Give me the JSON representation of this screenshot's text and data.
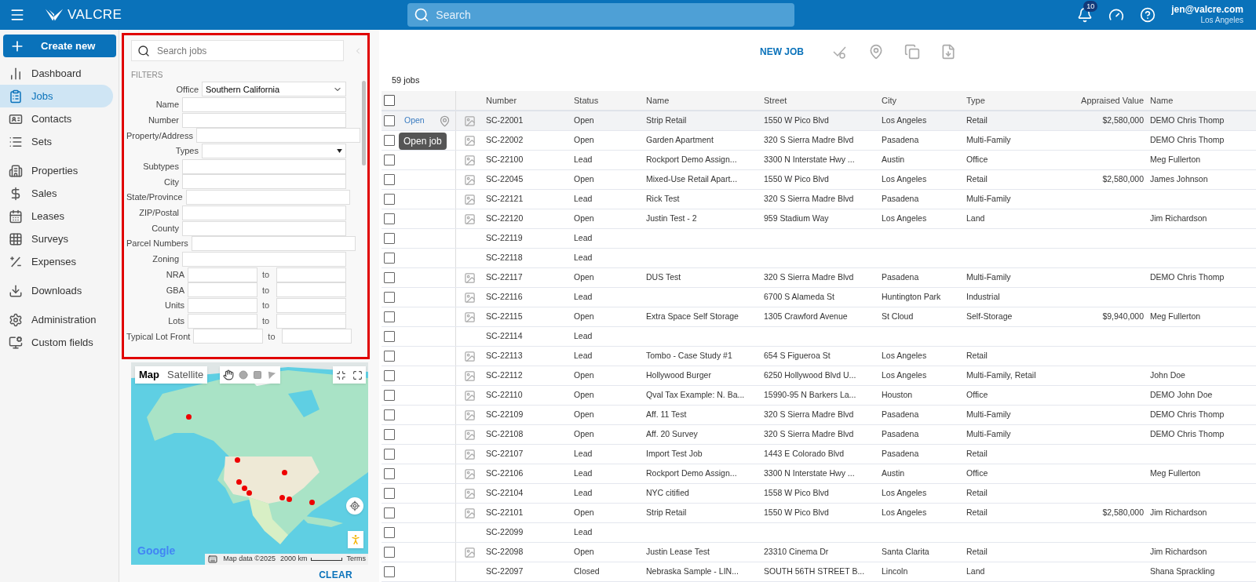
{
  "topbar": {
    "brand": "VALCRE",
    "search_placeholder": "Search",
    "notifications": "10",
    "user": "jen@valcre.com",
    "location": "Los Angeles"
  },
  "sidebar": {
    "create_button": "Create new",
    "groups": [
      {
        "items": [
          {
            "label": "Dashboard",
            "selected": false
          },
          {
            "label": "Jobs",
            "selected": true
          },
          {
            "label": "Contacts",
            "selected": false
          },
          {
            "label": "Sets",
            "selected": false
          }
        ]
      },
      {
        "items": [
          {
            "label": "Properties",
            "selected": false
          },
          {
            "label": "Sales",
            "selected": false
          },
          {
            "label": "Leases",
            "selected": false
          },
          {
            "label": "Surveys",
            "selected": false
          },
          {
            "label": "Expenses",
            "selected": false
          }
        ]
      },
      {
        "items": [
          {
            "label": "Downloads",
            "selected": false
          }
        ]
      },
      {
        "items": [
          {
            "label": "Administration",
            "selected": false
          },
          {
            "label": "Custom fields",
            "selected": false
          }
        ]
      }
    ]
  },
  "filters": {
    "search_placeholder": "Search jobs",
    "heading": "FILTERS",
    "fields": [
      {
        "kind": "select",
        "label": "Office",
        "value": "Southern California"
      },
      {
        "kind": "text",
        "label": "Name"
      },
      {
        "kind": "text",
        "label": "Number"
      },
      {
        "kind": "text",
        "label": "Property/Address"
      },
      {
        "kind": "multiselect",
        "label": "Types"
      },
      {
        "kind": "text",
        "label": "Subtypes"
      },
      {
        "kind": "text",
        "label": "City"
      },
      {
        "kind": "text",
        "label": "State/Province"
      },
      {
        "kind": "text",
        "label": "ZIP/Postal"
      },
      {
        "kind": "text",
        "label": "County"
      },
      {
        "kind": "text",
        "label": "Parcel Numbers"
      },
      {
        "kind": "text",
        "label": "Zoning"
      },
      {
        "kind": "range",
        "label": "NRA",
        "separator": "to"
      },
      {
        "kind": "range",
        "label": "GBA",
        "separator": "to"
      },
      {
        "kind": "range",
        "label": "Units",
        "separator": "to"
      },
      {
        "kind": "range",
        "label": "Lots",
        "separator": "to"
      },
      {
        "kind": "range",
        "label": "Typical Lot Front",
        "separator": "to"
      }
    ]
  },
  "map": {
    "modes": [
      {
        "label": "Map",
        "selected": true
      },
      {
        "label": "Satellite",
        "selected": false
      }
    ],
    "logo": "Google",
    "attribution": "Map data ©2025",
    "scale": "2000 km",
    "terms": "Terms"
  },
  "clear_button": "CLEAR",
  "toolbar": {
    "new_job": "NEW JOB"
  },
  "count": "59 jobs",
  "table": {
    "columns": [
      "Number",
      "Status",
      "Name",
      "Street",
      "City",
      "Type",
      "Appraised Value",
      "Name"
    ],
    "open_link": "Open",
    "tooltip": "Open job",
    "select_all_checked": false,
    "rows": [
      {
        "hovered": true,
        "checked": false,
        "has_image": true,
        "cells": [
          "SC-22001",
          "Open",
          "Strip Retail",
          "1550 W Pico Blvd",
          "Los Angeles",
          "Retail",
          "$2,580,000",
          "DEMO Chris Thomp"
        ]
      },
      {
        "hovered": false,
        "checked": false,
        "has_image": true,
        "cells": [
          "SC-22002",
          "Open",
          "Garden Apartment",
          "320 S Sierra Madre Blvd",
          "Pasadena",
          "Multi-Family",
          "",
          "DEMO Chris Thomp"
        ]
      },
      {
        "hovered": false,
        "checked": false,
        "has_image": true,
        "cells": [
          "SC-22100",
          "Lead",
          "Rockport Demo Assign...",
          "3300 N Interstate Hwy ...",
          "Austin",
          "Office",
          "",
          "Meg Fullerton"
        ]
      },
      {
        "hovered": false,
        "checked": false,
        "has_image": true,
        "cells": [
          "SC-22045",
          "Open",
          "Mixed-Use Retail Apart...",
          "1550 W Pico Blvd",
          "Los Angeles",
          "Retail",
          "$2,580,000",
          "James Johnson"
        ]
      },
      {
        "hovered": false,
        "checked": false,
        "has_image": true,
        "cells": [
          "SC-22121",
          "Lead",
          "Rick Test",
          "320 S Sierra Madre Blvd",
          "Pasadena",
          "Multi-Family",
          "",
          ""
        ]
      },
      {
        "hovered": false,
        "checked": false,
        "has_image": true,
        "cells": [
          "SC-22120",
          "Open",
          "Justin Test - 2",
          "959 Stadium Way",
          "Los Angeles",
          "Land",
          "",
          "Jim Richardson"
        ]
      },
      {
        "hovered": false,
        "checked": false,
        "has_image": false,
        "cells": [
          "SC-22119",
          "Lead",
          "",
          "",
          "",
          "",
          "",
          ""
        ]
      },
      {
        "hovered": false,
        "checked": false,
        "has_image": false,
        "cells": [
          "SC-22118",
          "Lead",
          "",
          "",
          "",
          "",
          "",
          ""
        ]
      },
      {
        "hovered": false,
        "checked": false,
        "has_image": true,
        "cells": [
          "SC-22117",
          "Open",
          "DUS Test",
          "320 S Sierra Madre Blvd",
          "Pasadena",
          "Multi-Family",
          "",
          "DEMO Chris Thomp"
        ]
      },
      {
        "hovered": false,
        "checked": false,
        "has_image": true,
        "cells": [
          "SC-22116",
          "Lead",
          "",
          "6700 S Alameda St",
          "Huntington Park",
          "Industrial",
          "",
          ""
        ]
      },
      {
        "hovered": false,
        "checked": false,
        "has_image": true,
        "cells": [
          "SC-22115",
          "Open",
          "Extra Space Self Storage",
          "1305 Crawford Avenue",
          "St Cloud",
          "Self-Storage",
          "$9,940,000",
          "Meg Fullerton"
        ]
      },
      {
        "hovered": false,
        "checked": false,
        "has_image": false,
        "cells": [
          "SC-22114",
          "Lead",
          "",
          "",
          "",
          "",
          "",
          ""
        ]
      },
      {
        "hovered": false,
        "checked": false,
        "has_image": true,
        "cells": [
          "SC-22113",
          "Lead",
          "Tombo - Case Study #1",
          "654 S Figueroa St",
          "Los Angeles",
          "Retail",
          "",
          ""
        ]
      },
      {
        "hovered": false,
        "checked": false,
        "has_image": true,
        "cells": [
          "SC-22112",
          "Open",
          "Hollywood Burger",
          "6250 Hollywood Blvd U...",
          "Los Angeles",
          "Multi-Family, Retail",
          "",
          "John Doe"
        ]
      },
      {
        "hovered": false,
        "checked": false,
        "has_image": true,
        "cells": [
          "SC-22110",
          "Open",
          "Qval Tax Example: N. Ba...",
          "15990-95 N Barkers La...",
          "Houston",
          "Office",
          "",
          "DEMO John Doe"
        ]
      },
      {
        "hovered": false,
        "checked": false,
        "has_image": true,
        "cells": [
          "SC-22109",
          "Open",
          "Aff. 11 Test",
          "320 S Sierra Madre Blvd",
          "Pasadena",
          "Multi-Family",
          "",
          "DEMO Chris Thomp"
        ]
      },
      {
        "hovered": false,
        "checked": false,
        "has_image": true,
        "cells": [
          "SC-22108",
          "Open",
          "Aff. 20 Survey",
          "320 S Sierra Madre Blvd",
          "Pasadena",
          "Multi-Family",
          "",
          "DEMO Chris Thomp"
        ]
      },
      {
        "hovered": false,
        "checked": false,
        "has_image": true,
        "cells": [
          "SC-22107",
          "Lead",
          "Import Test Job",
          "1443 E Colorado Blvd",
          "Pasadena",
          "Retail",
          "",
          ""
        ]
      },
      {
        "hovered": false,
        "checked": false,
        "has_image": true,
        "cells": [
          "SC-22106",
          "Lead",
          "Rockport Demo Assign...",
          "3300 N Interstate Hwy ...",
          "Austin",
          "Office",
          "",
          "Meg Fullerton"
        ]
      },
      {
        "hovered": false,
        "checked": false,
        "has_image": true,
        "cells": [
          "SC-22104",
          "Lead",
          "NYC citified",
          "1558 W Pico Blvd",
          "Los Angeles",
          "Retail",
          "",
          ""
        ]
      },
      {
        "hovered": false,
        "checked": false,
        "has_image": true,
        "cells": [
          "SC-22101",
          "Open",
          "Strip Retail",
          "1550 W Pico Blvd",
          "Los Angeles",
          "Retail",
          "$2,580,000",
          "Jim Richardson"
        ]
      },
      {
        "hovered": false,
        "checked": false,
        "has_image": false,
        "cells": [
          "SC-22099",
          "Lead",
          "",
          "",
          "",
          "",
          "",
          ""
        ]
      },
      {
        "hovered": false,
        "checked": false,
        "has_image": true,
        "cells": [
          "SC-22098",
          "Open",
          "Justin Lease Test",
          "23310 Cinema Dr",
          "Santa Clarita",
          "Retail",
          "",
          "Jim Richardson"
        ]
      },
      {
        "hovered": false,
        "checked": false,
        "has_image": false,
        "cells": [
          "SC-22097",
          "Closed",
          "Nebraska Sample - LIN...",
          "SOUTH 56TH STREET B...",
          "Lincoln",
          "Land",
          "",
          "Shana Sprackling"
        ]
      }
    ]
  }
}
